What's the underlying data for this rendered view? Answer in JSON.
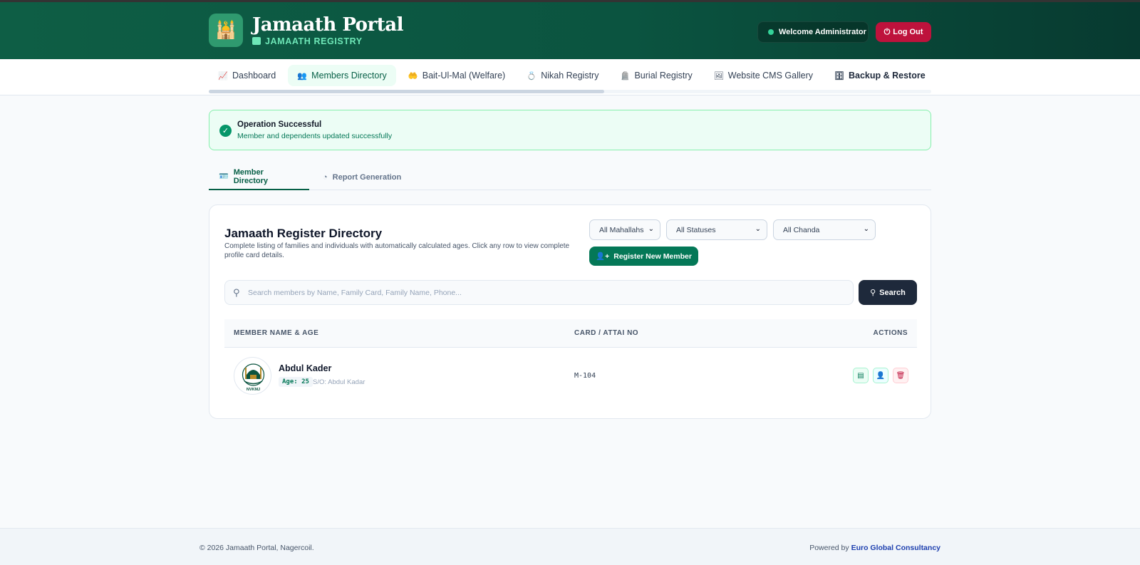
{
  "header": {
    "title": "Jamaath Portal",
    "subtitle": "JAMAATH REGISTRY",
    "welcome": "Welcome Administrator",
    "logout": "Log Out",
    "colors": {
      "primary": "#0b5440",
      "accent": "#6ee7b7",
      "danger": "#be123c"
    }
  },
  "nav": {
    "items": [
      {
        "label": "Dashboard",
        "icon": "chart-line-icon"
      },
      {
        "label": "Members Directory",
        "icon": "users-icon"
      },
      {
        "label": "Bait-Ul-Mal (Welfare)",
        "icon": "hand-coins-icon"
      },
      {
        "label": "Nikah Registry",
        "icon": "ring-icon"
      },
      {
        "label": "Burial Registry",
        "icon": "monument-icon"
      },
      {
        "label": "Website CMS Gallery",
        "icon": "images-icon"
      },
      {
        "label": "Backup & Restore",
        "icon": "database-icon"
      }
    ]
  },
  "alert": {
    "title": "Operation Successful",
    "message": "Member and dependents updated successfully"
  },
  "subtabs": {
    "directory": "Member Directory",
    "reports": "Report Generation"
  },
  "directory": {
    "title": "Jamaath Register Directory",
    "description": "Complete listing of families and individuals with automatically calculated ages. Click any row to view complete profile card details.",
    "filters": {
      "mahallah": "All Mahallahs",
      "status": "All Statuses",
      "chanda": "All Chanda"
    },
    "register_button": "Register New Member",
    "search": {
      "placeholder": "Search members by Name, Family Card, Family Name, Phone...",
      "button": "Search"
    },
    "columns": {
      "name": "MEMBER NAME & AGE",
      "card": "CARD / ATTAI NO",
      "actions": "ACTIONS"
    },
    "rows": [
      {
        "name": "Abdul Kader",
        "age": "Age: 25",
        "parent": "S/O: Abdul Kadar",
        "card_no": "M-104",
        "avatar_text": "NVKMJ"
      }
    ]
  },
  "footer": {
    "copyright": "© 2026 Jamaath Portal, Nagercoil.",
    "powered_by": "Powered by",
    "company": "Euro Global Consultancy"
  }
}
